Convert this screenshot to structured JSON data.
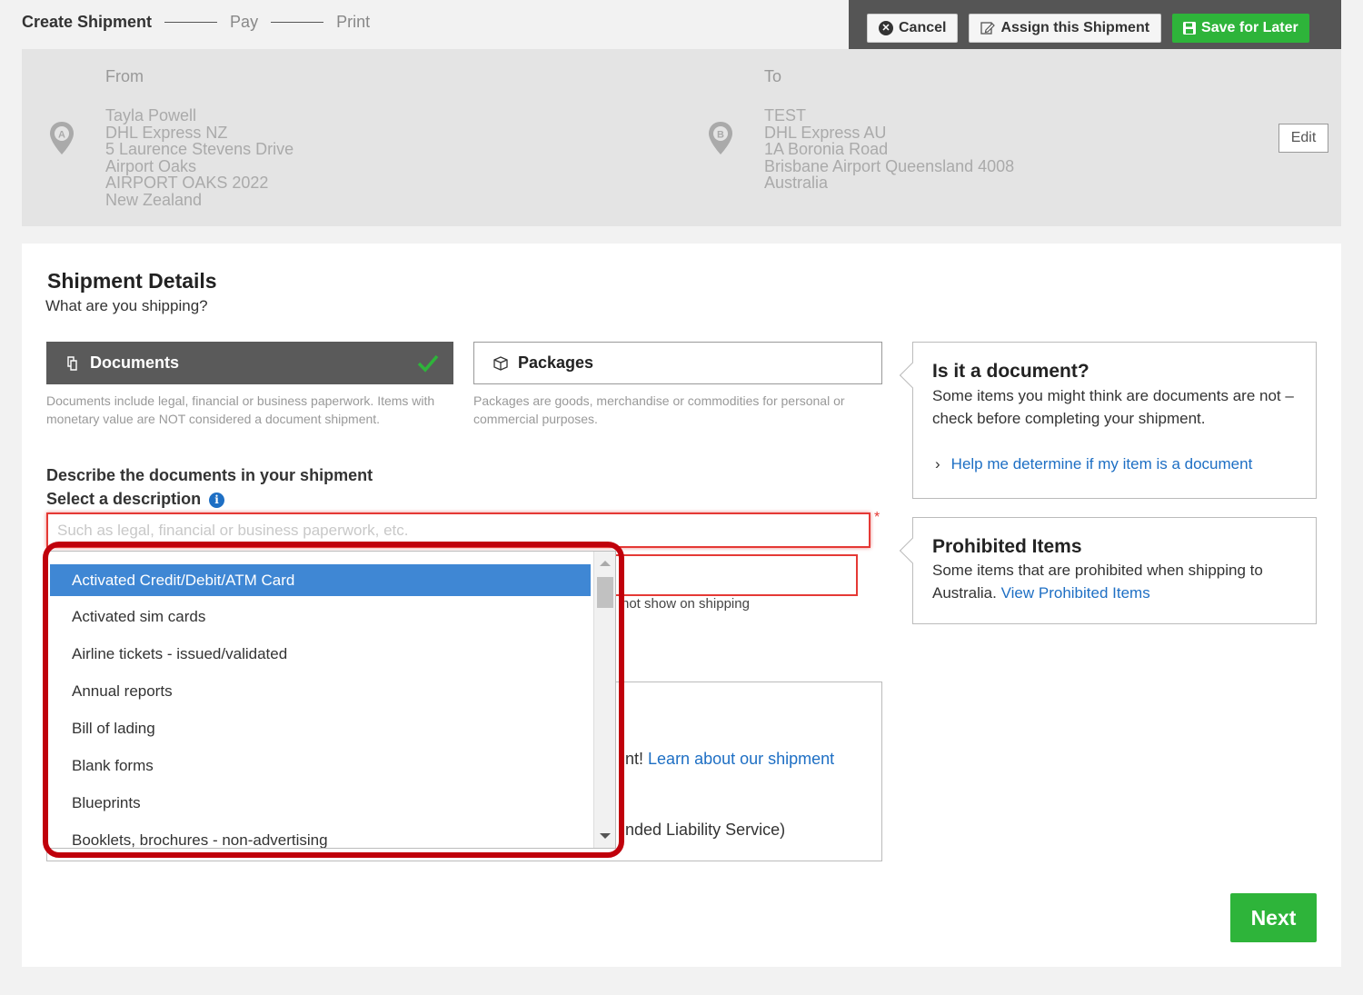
{
  "steps": {
    "create": "Create Shipment",
    "pay": "Pay",
    "print": "Print"
  },
  "actions": {
    "cancel": "Cancel",
    "assign": "Assign this Shipment",
    "save": "Save for Later"
  },
  "from": {
    "label": "From",
    "pin": "A",
    "lines": [
      "Tayla Powell",
      "DHL Express NZ",
      "5 Laurence Stevens Drive",
      "Airport Oaks",
      "AIRPORT OAKS 2022",
      "New Zealand"
    ]
  },
  "to": {
    "label": "To",
    "pin": "B",
    "lines": [
      "TEST",
      "DHL Express AU",
      "1A Boronia Road",
      "Brisbane Airport Queensland 4008",
      "Australia"
    ]
  },
  "edit_label": "Edit",
  "details": {
    "title": "Shipment Details",
    "subtitle": "What are you shipping?",
    "documents": {
      "label": "Documents",
      "desc": "Documents include legal, financial or business paperwork. Items with monetary value are NOT considered a document shipment."
    },
    "packages": {
      "label": "Packages",
      "desc": "Packages are goods, merchandise or commodities for personal or commercial purposes."
    },
    "describe_label": "Describe the documents in your shipment",
    "select_label": "Select a description",
    "placeholder": "Such as legal, financial or business paperwork, etc.",
    "required": "*",
    "hidden_note": "not show on shipping",
    "protect_text": "nt!",
    "protect_link": "Learn about our shipment",
    "liability_text": "nded Liability Service)"
  },
  "dropdown": {
    "items": [
      "Activated Credit/Debit/ATM Card",
      "Activated sim cards",
      "Airline tickets - issued/validated",
      "Annual reports",
      "Bill of lading",
      "Blank forms",
      "Blueprints",
      "Booklets, brochures - non-advertising"
    ],
    "selected_index": 0
  },
  "doc_info": {
    "title": "Is it a document?",
    "body": "Some items you might think are documents are not – check before completing your shipment.",
    "link": "Help me determine if my item is a document"
  },
  "prohibited": {
    "title": "Prohibited Items",
    "body": "Some items that are prohibited when shipping to Australia.",
    "link": "View Prohibited Items"
  },
  "next_label": "Next",
  "colors": {
    "accent_green": "#2eb43a",
    "link_blue": "#1e6fc4",
    "error_red": "#e53935",
    "selected_blue": "#3f87d4",
    "highlight": "#c0000b"
  }
}
